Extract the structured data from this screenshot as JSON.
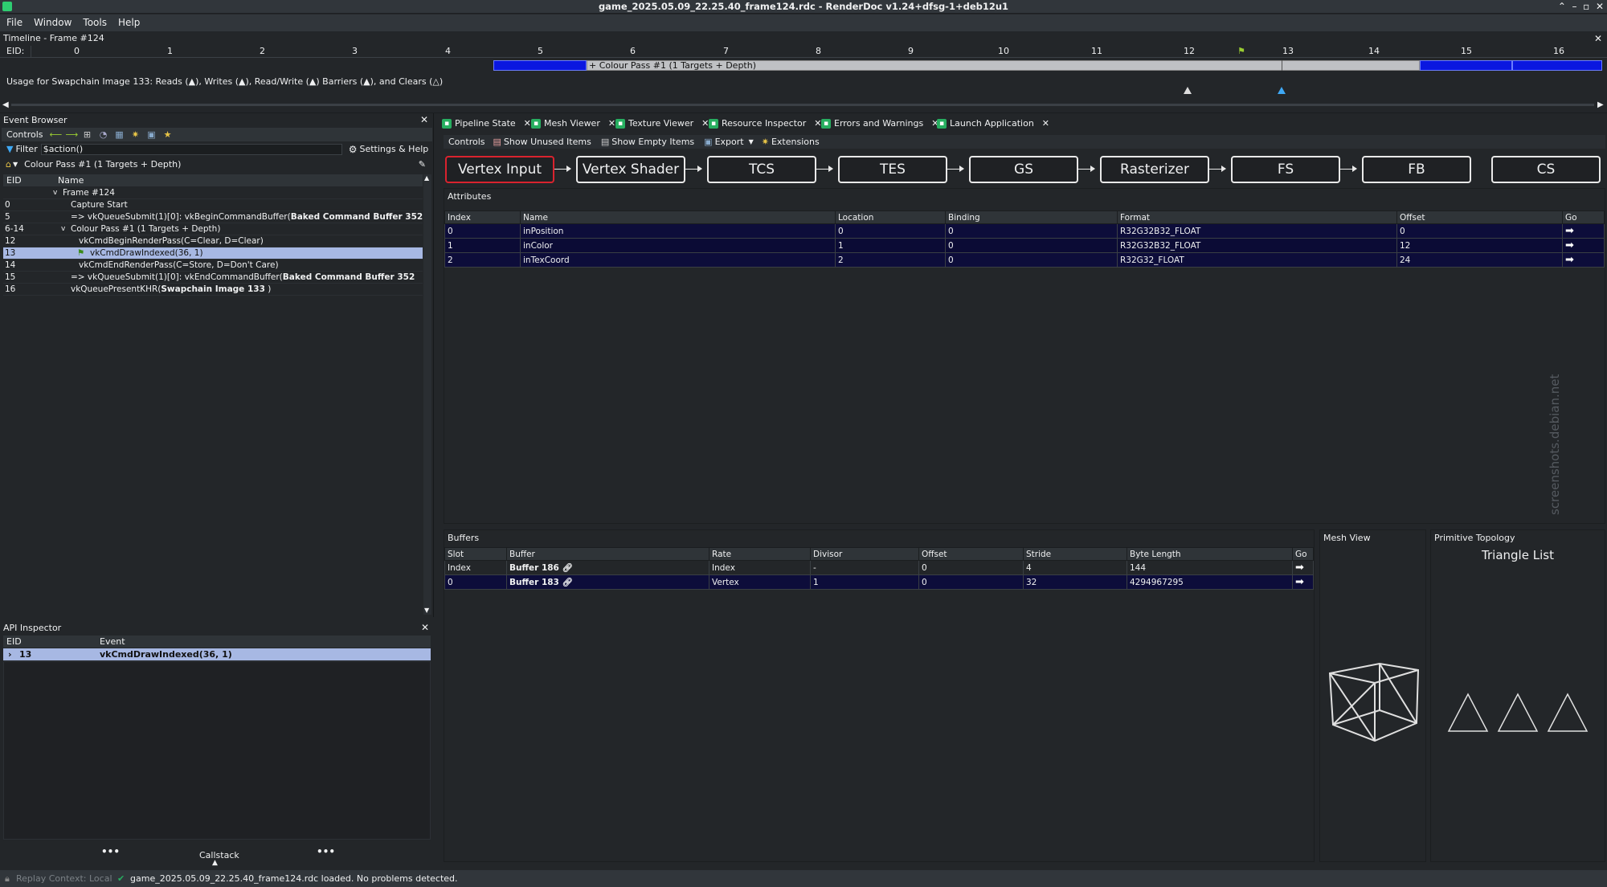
{
  "window": {
    "title": "game_2025.05.09_22.25.40_frame124.rdc - RenderDoc v1.24+dfsg-1+deb12u1"
  },
  "menu": [
    "File",
    "Window",
    "Tools",
    "Help"
  ],
  "timeline": {
    "title": "Timeline - Frame #124",
    "eid_label": "EID:",
    "ticks": [
      "0",
      "1",
      "2",
      "3",
      "4",
      "5",
      "6",
      "7",
      "8",
      "9",
      "10",
      "11",
      "12",
      "13",
      "14",
      "15",
      "16"
    ],
    "pass_label": "+ Colour Pass #1 (1 Targets + Depth)",
    "usage_text": "Usage for Swapchain Image 133: Reads (▲), Writes (▲), Read/Write (▲) Barriers (▲), and Clears (△)"
  },
  "event_browser": {
    "title": "Event Browser",
    "controls_label": "Controls",
    "filter_label": "Filter",
    "filter_value": "$action()",
    "settings_label": "Settings & Help",
    "breadcrumb": "Colour Pass #1 (1 Targets + Depth)",
    "columns": [
      "EID",
      "Name"
    ],
    "rows": [
      {
        "eid": "",
        "name": "Frame #124",
        "bold": ""
      },
      {
        "eid": "0",
        "name": "Capture Start",
        "bold": ""
      },
      {
        "eid": "5",
        "name": "=> vkQueueSubmit(1)[0]: vkBeginCommandBuffer(",
        "bold": "Baked Command Buffer 352"
      },
      {
        "eid": "6-14",
        "name": "Colour Pass #1 (1 Targets + Depth)",
        "bold": ""
      },
      {
        "eid": "12",
        "name": "vkCmdBeginRenderPass(C=Clear, D=Clear)",
        "bold": ""
      },
      {
        "eid": "13",
        "name": "vkCmdDrawIndexed(36, 1)",
        "bold": ""
      },
      {
        "eid": "14",
        "name": "vkCmdEndRenderPass(C=Store, D=Don't Care)",
        "bold": ""
      },
      {
        "eid": "15",
        "name": "=> vkQueueSubmit(1)[0]: vkEndCommandBuffer(",
        "bold": "Baked Command Buffer 352"
      },
      {
        "eid": "16",
        "name": "vkQueuePresentKHR(",
        "bold": "Swapchain Image 133"
      }
    ]
  },
  "api_inspector": {
    "title": "API Inspector",
    "columns": [
      "EID",
      "Event"
    ],
    "row": {
      "eid": "13",
      "event": "vkCmdDrawIndexed(36, 1)"
    },
    "callstack_label": "Callstack"
  },
  "tabs": [
    "Pipeline State",
    "Mesh Viewer",
    "Texture Viewer",
    "Resource Inspector",
    "Errors and Warnings",
    "Launch Application"
  ],
  "pipeline": {
    "controls_label": "Controls",
    "show_unused": "Show Unused Items",
    "show_empty": "Show Empty Items",
    "export": "Export",
    "extensions": "Extensions",
    "stages": [
      "Vertex Input",
      "Vertex Shader",
      "TCS",
      "TES",
      "GS",
      "Rasterizer",
      "FS",
      "FB",
      "CS"
    ],
    "attributes_label": "Attributes",
    "attr_columns": [
      "Index",
      "Name",
      "Location",
      "Binding",
      "Format",
      "Offset",
      "Go"
    ],
    "attributes": [
      [
        "0",
        "inPosition",
        "0",
        "0",
        "R32G32B32_FLOAT",
        "0"
      ],
      [
        "1",
        "inColor",
        "1",
        "0",
        "R32G32B32_FLOAT",
        "12"
      ],
      [
        "2",
        "inTexCoord",
        "2",
        "0",
        "R32G32_FLOAT",
        "24"
      ]
    ],
    "buffers_label": "Buffers",
    "buf_columns": [
      "Slot",
      "Buffer",
      "Rate",
      "Divisor",
      "Offset",
      "Stride",
      "Byte Length",
      "Go"
    ],
    "buffers": [
      [
        "Index",
        "Buffer 186",
        "Index",
        "-",
        "0",
        "4",
        "144"
      ],
      [
        "0",
        "Buffer 183",
        "Vertex",
        "1",
        "0",
        "32",
        "4294967295"
      ]
    ],
    "mesh_view_label": "Mesh View",
    "topology_label": "Primitive Topology",
    "topology_value": "Triangle List"
  },
  "watermark": "screenshots.debian.net",
  "status": {
    "replay": "Replay Context: Local",
    "message": "game_2025.05.09_22.25.40_frame124.rdc loaded. No problems detected."
  }
}
